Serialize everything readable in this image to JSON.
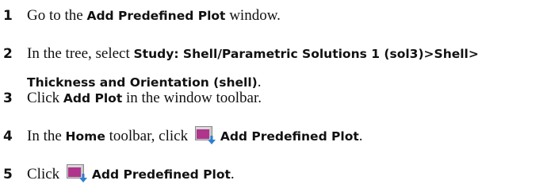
{
  "steps": [
    {
      "number": "1",
      "pre": "Go to the ",
      "bold": "Add Predefined Plot",
      "post": " window."
    },
    {
      "number": "2",
      "pre": "In the tree, select ",
      "bold1": "Study: Shell/Parametric Solutions 1 (sol3)>Shell>",
      "bold2": "Thickness and Orientation (shell)",
      "post": "."
    },
    {
      "number": "3",
      "pre": "Click ",
      "bold": "Add Plot",
      "post": " in the window toolbar."
    },
    {
      "number": "4",
      "pre": "In the ",
      "bold": "Home",
      "mid": " toolbar, click ",
      "icon": "add-predefined-plot-icon",
      "bold2": "Add Predefined Plot",
      "post": "."
    },
    {
      "number": "5",
      "pre": "Click ",
      "icon": "add-predefined-plot-icon",
      "bold": "Add Predefined Plot",
      "post": "."
    }
  ]
}
